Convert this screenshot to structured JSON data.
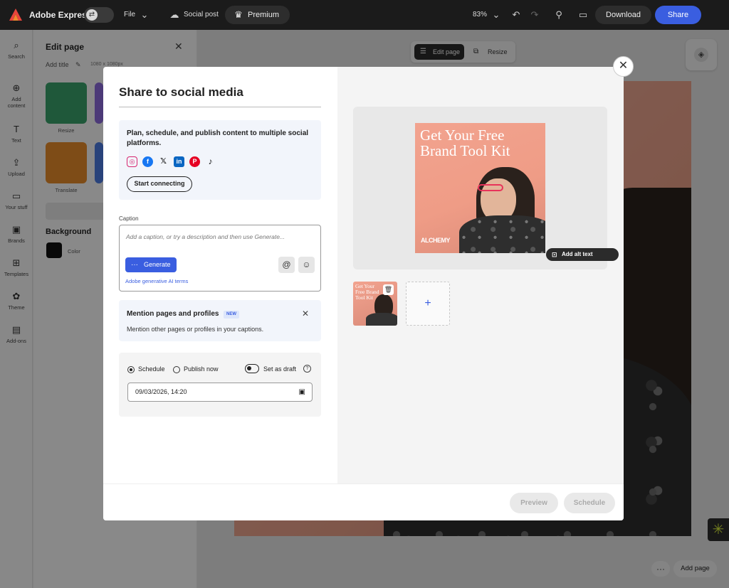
{
  "topbar": {
    "app_name": "Adobe Express",
    "file_label": "File",
    "doc_type": "Social post",
    "premium_label": "Premium",
    "zoom": "83%",
    "download_label": "Download",
    "share_label": "Share"
  },
  "rail": {
    "items": [
      {
        "label": "Search",
        "icon": "search-icon"
      },
      {
        "label": "Add content",
        "icon": "plus-circle-icon"
      },
      {
        "label": "Text",
        "icon": "text-icon"
      },
      {
        "label": "Upload",
        "icon": "upload-icon"
      },
      {
        "label": "Your stuff",
        "icon": "folder-icon"
      },
      {
        "label": "Brands",
        "icon": "brand-icon"
      },
      {
        "label": "Templates",
        "icon": "templates-icon"
      },
      {
        "label": "Theme",
        "icon": "palette-icon"
      },
      {
        "label": "Add-ons",
        "icon": "addons-icon"
      }
    ]
  },
  "panel": {
    "title": "Edit page",
    "add_title": "Add title",
    "size": "1080 x 1080px",
    "tiles": [
      {
        "label": "Resize"
      },
      {
        "label": "Translate"
      }
    ],
    "background_title": "Background",
    "color_label": "Color"
  },
  "canvas_toolbar": {
    "edit_page": "Edit page",
    "resize": "Resize"
  },
  "canvas_footer": {
    "add_page": "Add page"
  },
  "modal": {
    "title": "Share to social media",
    "connect_text": "Plan, schedule, and publish content to multiple social platforms.",
    "social_icons": [
      "instagram-icon",
      "facebook-icon",
      "x-icon",
      "linkedin-icon",
      "pinterest-icon",
      "tiktok-icon"
    ],
    "start_connecting": "Start connecting",
    "caption_label": "Caption",
    "caption_placeholder": "Add a caption, or try a description and then use Generate...",
    "generate_label": "Generate",
    "ai_terms": "Adobe generative AI terms",
    "mention_title": "Mention pages and profiles",
    "mention_badge": "NEW",
    "mention_body": "Mention other pages or profiles in your captions.",
    "schedule_label": "Schedule",
    "publish_now_label": "Publish now",
    "draft_label": "Set as draft",
    "datetime": "09/03/2026, 14:20",
    "preview_title": "Get Your Free Brand Tool Kit",
    "preview_brand": "ALCHEMY",
    "thumb_title": "Get Your Free Brand Tool Kit",
    "alt_text": "Add alt text",
    "preview_btn": "Preview",
    "schedule_btn": "Schedule"
  },
  "colors": {
    "accent": "#3a5ee0",
    "topbar": "#1b1b1b"
  }
}
